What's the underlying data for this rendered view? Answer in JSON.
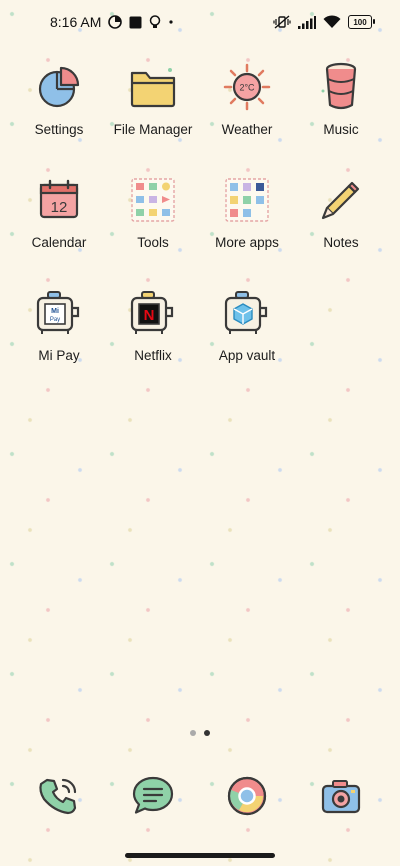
{
  "status": {
    "time": "8:16 AM",
    "battery": "100"
  },
  "apps": [
    {
      "label": "Settings"
    },
    {
      "label": "File Manager"
    },
    {
      "label": "Weather",
      "temp": "2°C"
    },
    {
      "label": "Music"
    },
    {
      "label": "Calendar",
      "day": "12"
    },
    {
      "label": "Tools"
    },
    {
      "label": "More apps"
    },
    {
      "label": "Notes"
    },
    {
      "label": "Mi Pay",
      "badge_line1": "Mi",
      "badge_line2": "Pay"
    },
    {
      "label": "Netflix",
      "badge": "N"
    },
    {
      "label": "App vault"
    }
  ],
  "pager": {
    "pages": 2,
    "active": 2
  },
  "dock": [
    {
      "icon": "phone-icon"
    },
    {
      "icon": "messages-icon"
    },
    {
      "icon": "chrome-icon"
    },
    {
      "icon": "camera-icon"
    }
  ],
  "colors": {
    "background": "#fbf6e9",
    "outline": "#3a3a3a",
    "accent_pink": "#f08c8c",
    "accent_blue": "#8fc0e8",
    "accent_yellow": "#f3d373",
    "accent_green": "#8fd1a8"
  }
}
